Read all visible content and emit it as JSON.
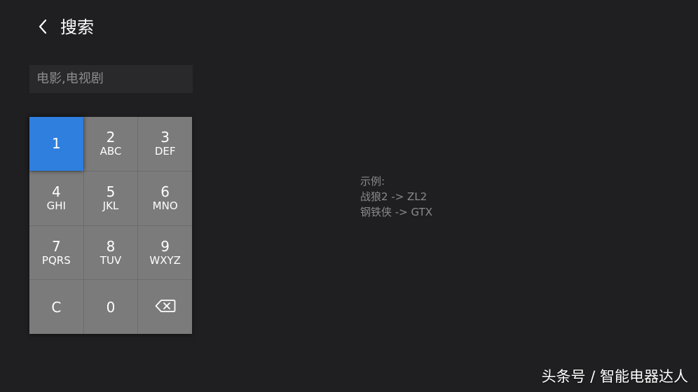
{
  "header": {
    "back_icon": "chevron-left-icon",
    "title": "搜索"
  },
  "search": {
    "placeholder": "电影,电视剧",
    "value": ""
  },
  "keypad": {
    "keys": [
      {
        "digit": "1",
        "letters": "",
        "focused": true
      },
      {
        "digit": "2",
        "letters": "ABC"
      },
      {
        "digit": "3",
        "letters": "DEF"
      },
      {
        "digit": "4",
        "letters": "GHI"
      },
      {
        "digit": "5",
        "letters": "JKL"
      },
      {
        "digit": "6",
        "letters": "MNO"
      },
      {
        "digit": "7",
        "letters": "PQRS"
      },
      {
        "digit": "8",
        "letters": "TUV"
      },
      {
        "digit": "9",
        "letters": "WXYZ"
      },
      {
        "digit": "C",
        "letters": ""
      },
      {
        "digit": "0",
        "letters": ""
      },
      {
        "icon": "backspace-icon"
      }
    ],
    "focus_color": "#2f7fdf",
    "key_color": "#7b7b7b"
  },
  "hint": {
    "title": "示例:",
    "example_1": "战狼2 -> ZL2",
    "example_2": "钢铁侠 -> GTX"
  },
  "watermark": {
    "text": "头条号 / 智能电器达人"
  },
  "colors": {
    "background": "#1f1f21",
    "search_field": "#29292b"
  }
}
